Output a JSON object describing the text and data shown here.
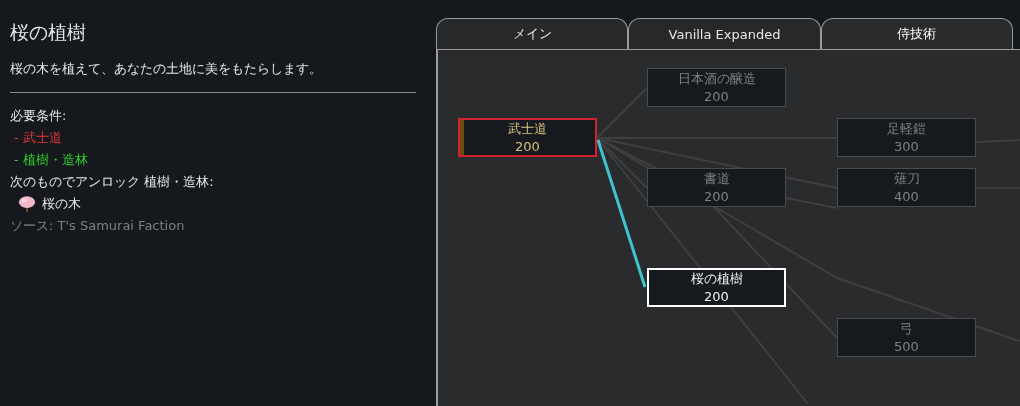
{
  "detail": {
    "title": "桜の植樹",
    "description": "桜の木を植えて、あなたの土地に美をもたらします。",
    "prerequisites_label": "必要条件:",
    "prerequisites": [
      {
        "label": "- 武士道",
        "met": false
      },
      {
        "label": "- 植樹・造林",
        "met": true
      }
    ],
    "unlocks_label": "次のものでアンロック 植樹・造林:",
    "unlocks": [
      {
        "label": "桜の木"
      }
    ],
    "source": "ソース:  T's Samurai Faction"
  },
  "tabs": [
    {
      "label": "メイン",
      "selected": false
    },
    {
      "label": "Vanilla Expanded",
      "selected": false
    },
    {
      "label": "侍技術",
      "selected": true
    }
  ],
  "nodes": [
    {
      "name": "日本酒の醸造",
      "cost": "200",
      "researching": false,
      "selected": false
    },
    {
      "name": "武士道",
      "cost": "200",
      "researching": true,
      "selected": false,
      "level": 0.03
    },
    {
      "name": "足軽鎧",
      "cost": "300",
      "researching": false,
      "selected": false
    },
    {
      "name": "書道",
      "cost": "200",
      "researching": false,
      "selected": false
    },
    {
      "name": "薙刀",
      "cost": "400",
      "researching": false,
      "selected": false
    },
    {
      "name": "桜の植樹",
      "cost": "200",
      "researching": false,
      "selected": true
    },
    {
      "name": "弓",
      "cost": "500",
      "researching": false,
      "selected": false
    }
  ]
}
